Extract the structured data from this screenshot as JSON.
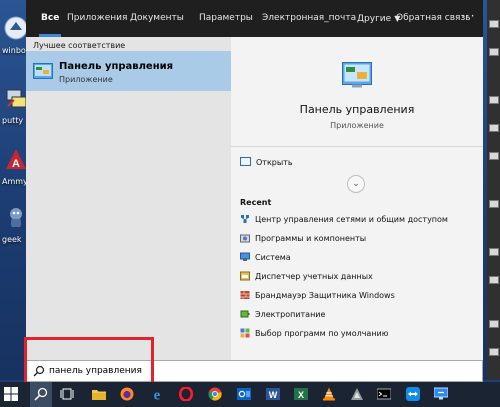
{
  "desktop": {
    "icons": [
      {
        "label": "winbox",
        "icon": "winbox-icon"
      },
      {
        "label": "putty",
        "icon": "putty-icon"
      },
      {
        "label": "AmmyAdm",
        "icon": "ammyy-admin-icon"
      },
      {
        "label": "geek",
        "icon": "geek-uninstaller-icon"
      }
    ]
  },
  "menu": {
    "tabs": [
      "Все",
      "Приложения",
      "Документы",
      "Параметры",
      "Электронная_почта",
      "Другие",
      "Обратная связь"
    ],
    "more_label": "···",
    "best_match_header": "Лучшее соответствие",
    "best_match": {
      "name": "Панель управления",
      "type": "Приложение",
      "icon": "control-panel-icon"
    },
    "detail": {
      "title": "Панель управления",
      "subtitle": "Приложение",
      "icon": "control-panel-icon"
    },
    "open_label": "Открыть",
    "recent_header": "Recent",
    "recent": [
      {
        "label": "Центр управления сетями и общим доступом",
        "icon": "network-center-icon"
      },
      {
        "label": "Программы и компоненты",
        "icon": "programs-features-icon"
      },
      {
        "label": "Система",
        "icon": "system-icon"
      },
      {
        "label": "Диспетчер учетных данных",
        "icon": "credential-manager-icon"
      },
      {
        "label": "Брандмауэр Защитника Windows",
        "icon": "firewall-icon"
      },
      {
        "label": "Электропитание",
        "icon": "power-options-icon"
      },
      {
        "label": "Выбор программ по умолчанию",
        "icon": "default-programs-icon"
      }
    ]
  },
  "search": {
    "value": "панель управления",
    "icon": "search-icon"
  },
  "colors": {
    "accent": "#3f86d9",
    "highlight_box": "#e3232c",
    "selected_item": "#aacbe8",
    "taskbar": "#1a2433"
  },
  "taskbar": [
    "windows-start-icon",
    "search-icon",
    "task-view-icon",
    "file-explorer-icon",
    "firefox-icon",
    "edge-icon",
    "opera-icon",
    "chrome-icon",
    "outlook-icon",
    "word-icon",
    "excel-icon",
    "vlc-icon",
    "app-icon",
    "terminal-icon",
    "teamviewer-icon",
    "remote-desktop-icon"
  ]
}
